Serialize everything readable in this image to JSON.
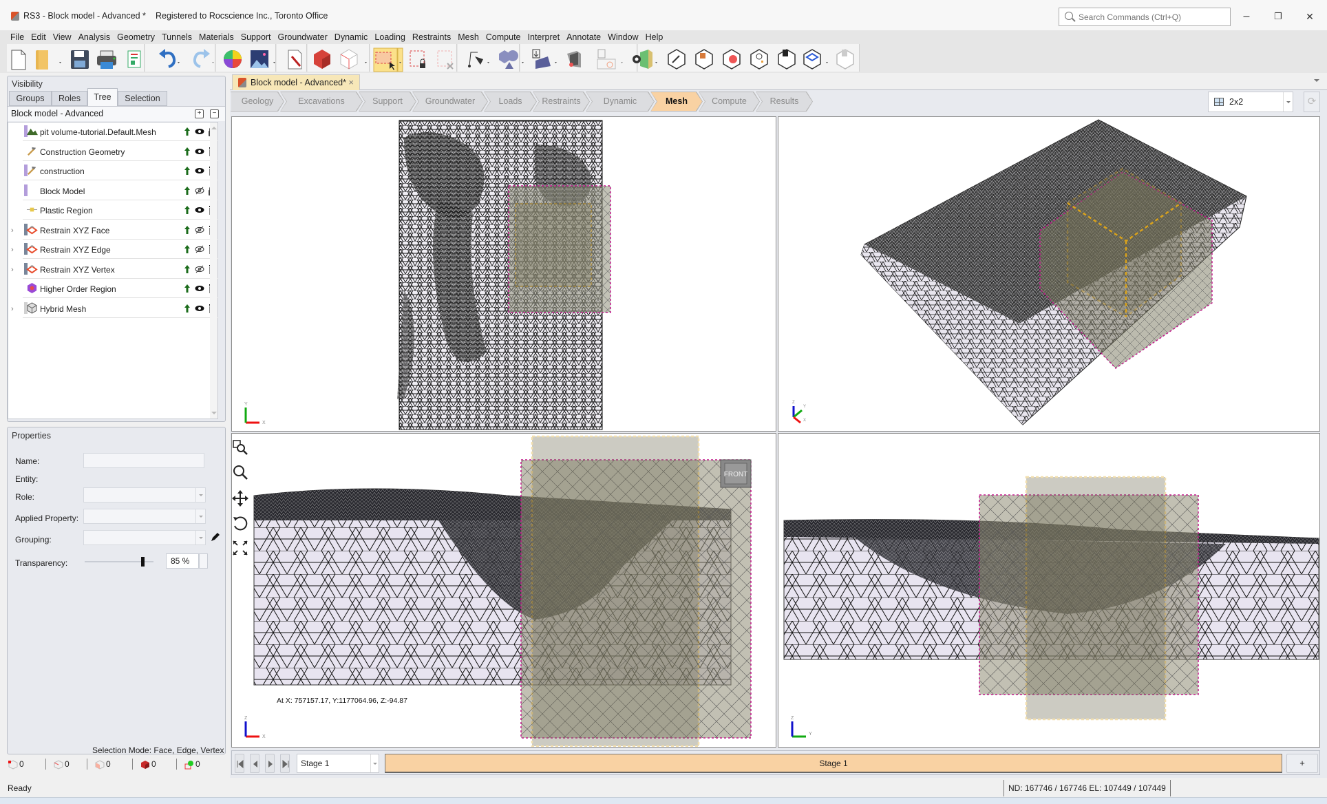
{
  "window": {
    "title": "RS3 - Block model - Advanced *",
    "registration": "Registered to Rocscience Inc., Toronto Office",
    "search_placeholder": "Search Commands (Ctrl+Q)",
    "minimize": "–",
    "restore": "❐",
    "close": "✕"
  },
  "menu": [
    "File",
    "Edit",
    "View",
    "Analysis",
    "Geometry",
    "Tunnels",
    "Materials",
    "Support",
    "Groundwater",
    "Dynamic",
    "Loading",
    "Restraints",
    "Mesh",
    "Compute",
    "Interpret",
    "Annotate",
    "Window",
    "Help"
  ],
  "toolbar": {
    "buttons": [
      "new-file",
      "open-folder",
      "save",
      "print",
      "report",
      "undo",
      "redo",
      "color-wheel",
      "image-background",
      "edit-tool",
      "block-3d",
      "wire-box",
      "select-window",
      "select-lock",
      "deselect",
      "polyline-pen",
      "shapes",
      "import-shape",
      "layers",
      "import-profile",
      "toggle-visibility",
      "edit-box",
      "table-box",
      "red-box",
      "search-box",
      "delete-box",
      "layer-box",
      "disabled-box"
    ]
  },
  "left_panel": {
    "visibility_title": "Visibility",
    "tabs": [
      "Groups",
      "Roles",
      "Tree",
      "Selection"
    ],
    "active_tab": "Tree",
    "model_name": "Block model - Advanced",
    "tree": [
      {
        "label": "pit volume-tutorial.Default.Mesh",
        "icon": "terrain-icon",
        "bar": "#b39ddb",
        "expandable": false,
        "visible": true,
        "lock": "locked"
      },
      {
        "label": "Construction Geometry",
        "icon": "hammer-icon",
        "bar": "",
        "expandable": false,
        "visible": true,
        "lock": "delete"
      },
      {
        "label": "construction",
        "icon": "hammer-icon",
        "bar": "#b39ddb",
        "expandable": false,
        "visible": true,
        "lock": "delete"
      },
      {
        "label": "Block Model",
        "icon": "",
        "bar": "#b39ddb",
        "expandable": false,
        "visible": false,
        "lock": "locked"
      },
      {
        "label": "Plastic Region",
        "icon": "plastic-region-icon",
        "bar": "",
        "expandable": false,
        "visible": true,
        "lock": "delete"
      },
      {
        "label": "Restrain XYZ Face",
        "icon": "restraint-icon",
        "bar": "#78869a",
        "expandable": true,
        "visible": false,
        "lock": "delete"
      },
      {
        "label": "Restrain XYZ Edge",
        "icon": "restraint-icon",
        "bar": "#78869a",
        "expandable": true,
        "visible": false,
        "lock": "delete"
      },
      {
        "label": "Restrain XYZ Vertex",
        "icon": "restraint-icon",
        "bar": "#78869a",
        "expandable": true,
        "visible": false,
        "lock": "delete"
      },
      {
        "label": "Higher Order Region",
        "icon": "higher-order-icon",
        "bar": "",
        "expandable": false,
        "visible": true,
        "lock": "delete"
      },
      {
        "label": "Hybrid Mesh",
        "icon": "hybrid-mesh-icon",
        "bar": "#d0d0d0",
        "expandable": true,
        "visible": true,
        "lock": "delete"
      }
    ],
    "properties": {
      "title": "Properties",
      "name_label": "Name:",
      "name_value": "",
      "entity_label": "Entity:",
      "role_label": "Role:",
      "applied_property_label": "Applied Property:",
      "grouping_label": "Grouping:",
      "transparency_label": "Transparency:",
      "transparency_value": "85 %",
      "transparency_percent": 85
    },
    "selection_mode": "Selection Mode: Face, Edge, Vertex",
    "selection_counts": [
      {
        "type": "vertex",
        "count": "0"
      },
      {
        "type": "edge",
        "count": "0"
      },
      {
        "type": "face",
        "count": "0"
      },
      {
        "type": "volume",
        "count": "0"
      },
      {
        "type": "support",
        "count": "0"
      }
    ]
  },
  "document": {
    "tab_title": "Block model - Advanced*",
    "workflow_tabs": [
      "Geology",
      "Excavations",
      "Support",
      "Groundwater",
      "Loads",
      "Restraints",
      "Dynamic",
      "Mesh",
      "Compute",
      "Results"
    ],
    "active_workflow": "Mesh",
    "layout": "2x2"
  },
  "viewports": {
    "top_left": {
      "view": "top",
      "axes": [
        "X",
        "Y"
      ]
    },
    "top_right": {
      "view": "perspective",
      "axes": [
        "X",
        "Y",
        "Z"
      ]
    },
    "bottom_left": {
      "view": "front",
      "axes": [
        "X",
        "Z"
      ],
      "coordinate_readout": "At X: 757157.17, Y:1177064.96, Z:-94.87",
      "view_cube_label": "FRONT"
    },
    "bottom_right": {
      "view": "side",
      "axes": [
        "Y",
        "Z"
      ]
    }
  },
  "stages": {
    "current": "Stage 1",
    "tabs": [
      "Stage 1"
    ],
    "add_label": "+"
  },
  "status": {
    "ready": "Ready",
    "counts": "ND: 167746 / 167746  EL: 107449 / 107449"
  },
  "colors": {
    "active_tab": "#f9d2a3",
    "excavation_box": "#d9a21b",
    "block_box": "#c2188b",
    "mesh_fill": "#e6e2ee"
  }
}
